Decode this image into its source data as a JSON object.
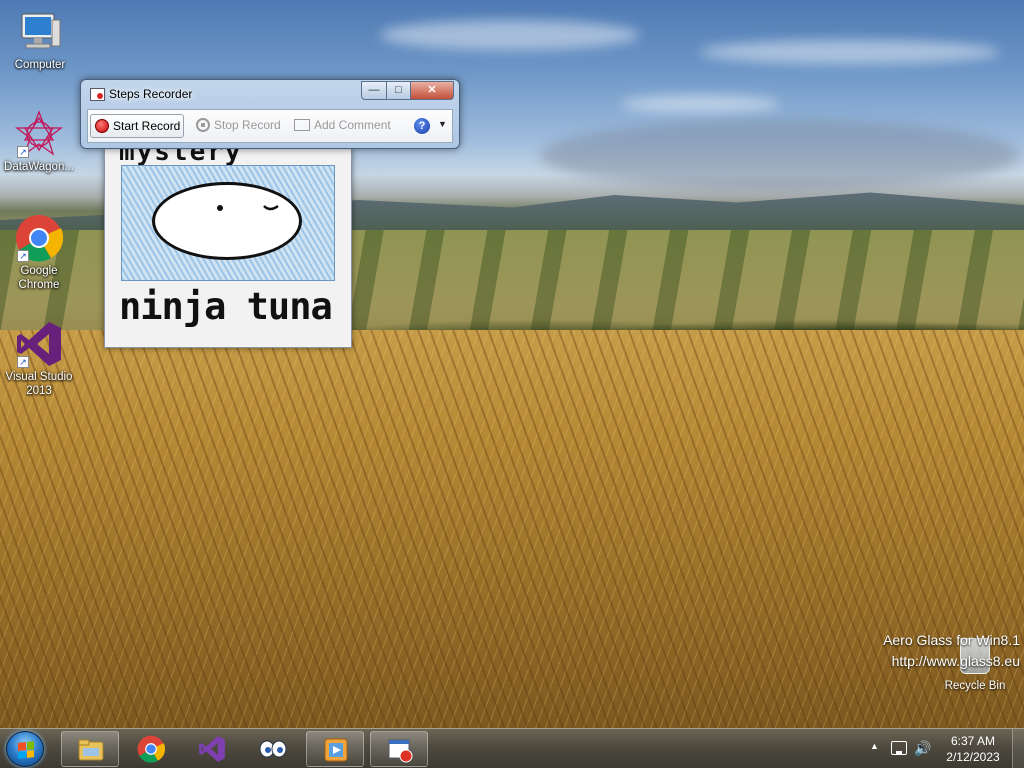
{
  "desktop_icons": [
    {
      "label": "Computer",
      "icon": "computer-icon"
    },
    {
      "label": "DataWagon...",
      "icon": "datawagon-icon"
    },
    {
      "label": "Google Chrome",
      "icon": "chrome-icon"
    },
    {
      "label": "Visual Studio 2013",
      "icon": "visual-studio-icon"
    }
  ],
  "steps_recorder": {
    "title": "Steps Recorder",
    "caption_buttons": {
      "minimize": "—",
      "maximize": "□",
      "close": "✕"
    },
    "toolbar": {
      "start_record": "Start Record",
      "stop_record": "Stop Record",
      "add_comment": "Add Comment",
      "help": "?",
      "dropdown": "▼"
    }
  },
  "background_window": {
    "caption": "ninja tuna",
    "top_text": "mystery"
  },
  "watermark": {
    "line1": "Aero Glass for Win8.1",
    "line2": "http://www.glass8.eu"
  },
  "recycle_bin": {
    "label": "Recycle Bin",
    "icon": "recycle-bin-icon"
  },
  "taskbar": {
    "items": [
      {
        "name": "file-explorer",
        "icon": "folder-icon"
      },
      {
        "name": "google-chrome",
        "icon": "chrome-icon"
      },
      {
        "name": "visual-studio",
        "icon": "visual-studio-icon"
      },
      {
        "name": "eyes-app",
        "icon": "eyes-icon"
      },
      {
        "name": "media-player",
        "icon": "media-player-icon"
      },
      {
        "name": "steps-recorder",
        "icon": "steps-recorder-icon"
      }
    ],
    "tray": {
      "chevron": "▲",
      "volume": "🔊",
      "time": "6:37 AM",
      "date": "2/12/2023"
    }
  },
  "colors": {
    "taskbar": "#4e4a3f",
    "record_red": "#c40000",
    "window_glass": "#b9cde4"
  }
}
